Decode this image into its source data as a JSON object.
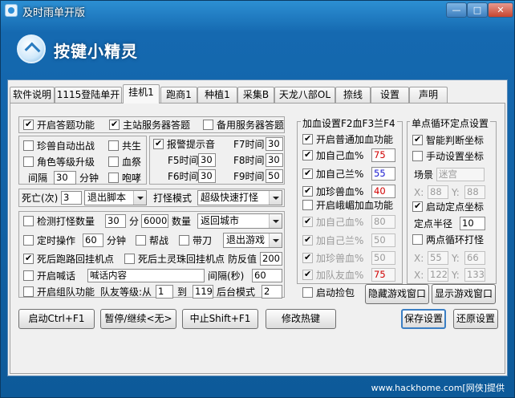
{
  "window": {
    "title": "及时雨单开版",
    "min": "—",
    "max": "□",
    "close": "✕"
  },
  "banner": {
    "logo_text": "按键小精灵"
  },
  "tabs": [
    "软件说明",
    "1115登陆单开",
    "挂机1",
    "跑商1",
    "种植1",
    "采集B",
    "天龙八部OL",
    "捺线",
    "设置",
    "声明"
  ],
  "left": {
    "top_row": {
      "answer": "开启答题功能",
      "main_server": "主站服务器答题",
      "backup_server": "备用服务器答题"
    },
    "pets": {
      "auto_battle": "珍兽自动出战",
      "level_upgrade": "角色等级升级",
      "interval_label": "间隔",
      "interval_value": "30",
      "minutes": "分钟",
      "gongsheng": "共生",
      "xueji": "血祭",
      "paoxiao": "咆哮"
    },
    "alarm": {
      "label": "报警提示音",
      "f5": "F5时间",
      "f5v": "30",
      "f6": "F6时间",
      "f6v": "30",
      "f7": "F7时间",
      "f7v": "30",
      "f8": "F8时间",
      "f8v": "30",
      "f9": "F9时间",
      "f9v": "50"
    },
    "death": {
      "label": "死亡(次)",
      "count": "3",
      "action": "退出脚本",
      "mode_label": "打怪模式",
      "mode": "超级快速打怪"
    },
    "opts": {
      "check_kills": "检测打怪数量",
      "kills_a": "30",
      "fen": "分",
      "kills_b": "6000",
      "qty": "数量",
      "return_city": "返回城市",
      "timed": "定时操作",
      "timed_v": "60",
      "minutes": "分钟",
      "bangzhan": "帮战",
      "daidao": "带刀",
      "exit_game": "退出游戏",
      "death_run": "死后跑路回挂机点",
      "death_pearl": "死后土灵珠回挂机点",
      "defense": "防反值",
      "defense_v": "200",
      "shout": "开启喊话",
      "shout_text": "喊话内容",
      "interval_sec": "间隔(秒)",
      "interval_sec_v": "60",
      "team": "开启组队功能",
      "team_level": "队友等级:从",
      "team_from": "1",
      "to": "到",
      "team_to": "119",
      "bg_mode": "后台模式",
      "bg_v": "2"
    }
  },
  "addblood": {
    "title": "加血设置F2血F3兰F4",
    "normal": "开启普通加血功能",
    "self_hp": "加自己血%",
    "self_hp_v": "75",
    "self_mp": "加自己兰%",
    "self_mp_v": "55",
    "pet_hp": "加珍兽血%",
    "pet_hp_v": "40",
    "emei": "开启峨嵋加血功能",
    "e_self_hp": "加自己血%",
    "e_self_hp_v": "80",
    "e_self_mp": "加自己兰%",
    "e_self_mp_v": "50",
    "e_pet_hp": "加珍兽血%",
    "e_pet_hp_v": "50",
    "e_friend": "加队友血%",
    "e_friend_v": "75",
    "pickup": "启动捡包"
  },
  "loop": {
    "title": "单点循环定点设置",
    "smart": "智能判断坐标",
    "manual": "手动设置坐标",
    "scene_label": "场景",
    "scene": "迷宫",
    "x1": "88",
    "y1": "88",
    "fixed": "启动定点坐标",
    "radius_label": "定点半径",
    "radius": "10",
    "two_point": "两点循环打怪",
    "x2": "55",
    "y2": "66",
    "x3": "122",
    "y3": "133"
  },
  "buttons": {
    "hide": "隐藏游戏窗口",
    "show": "显示游戏窗口",
    "start": "启动Ctrl+F1",
    "pause": "暂停/继续<无>",
    "stop": "中止Shift+F1",
    "hotkey": "修改热键",
    "save": "保存设置",
    "restore": "还原设置"
  },
  "watermark": "www.hackhome.com[网侠]提供"
}
